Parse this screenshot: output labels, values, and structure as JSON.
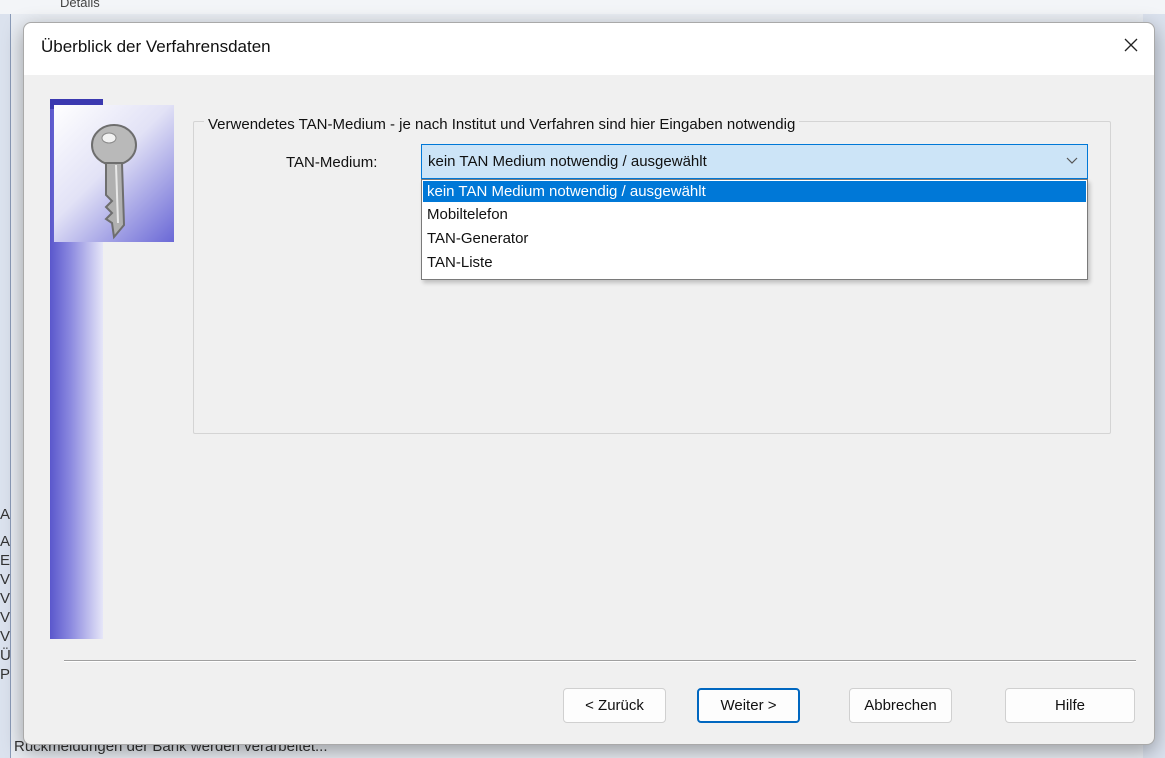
{
  "background": {
    "top_text": "Details",
    "left_list": [
      "A",
      "A",
      "E",
      "V",
      "V",
      "V",
      "V",
      "Ü",
      "P"
    ],
    "bottom_text": "Rückmeldungen der Bank werden verarbeitet..."
  },
  "dialog": {
    "title": "Überblick der Verfahrensdaten",
    "close_icon": "close-icon",
    "key_icon": "key-icon",
    "group_title": "Verwendetes TAN-Medium - je nach Institut und Verfahren sind hier Eingaben notwendig",
    "tan_label": "TAN-Medium:",
    "tan_selected": "kein TAN Medium notwendig / ausgewählt",
    "tan_options": [
      "kein TAN Medium notwendig / ausgewählt",
      "Mobiltelefon",
      "TAN-Generator",
      "TAN-Liste"
    ],
    "buttons": {
      "back": "< Zurück",
      "next": "Weiter >",
      "cancel": "Abbrechen",
      "help": "Hilfe"
    }
  },
  "colors": {
    "accent": "#0078d7",
    "selection": "#0078d7",
    "combo_bg": "#cce4f7",
    "sidebar": "#5a57cc"
  }
}
